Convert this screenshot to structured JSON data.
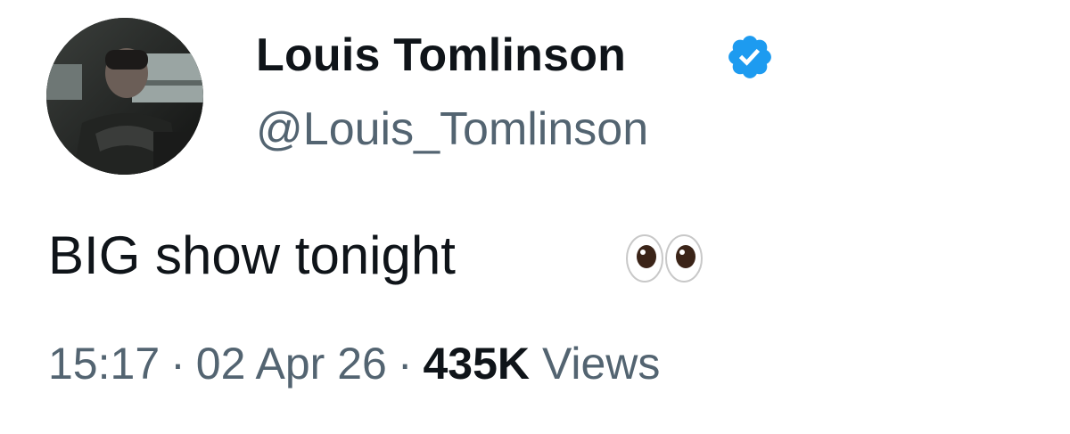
{
  "author": {
    "display_name": "Louis Tomlinson",
    "handle": "@Louis_Tomlinson",
    "verified": true,
    "verified_badge_icon": "verified-check-icon",
    "badge_color": "#1d9bf0"
  },
  "tweet": {
    "text": "BIG show tonight",
    "emoji_icon": "eyes-icon"
  },
  "meta": {
    "time": "15:17",
    "separator": "·",
    "date": "02 Apr 26",
    "views_count": "435K",
    "views_label": "Views"
  },
  "colors": {
    "text_primary": "#0f1419",
    "text_secondary": "#536471",
    "background": "#ffffff"
  }
}
